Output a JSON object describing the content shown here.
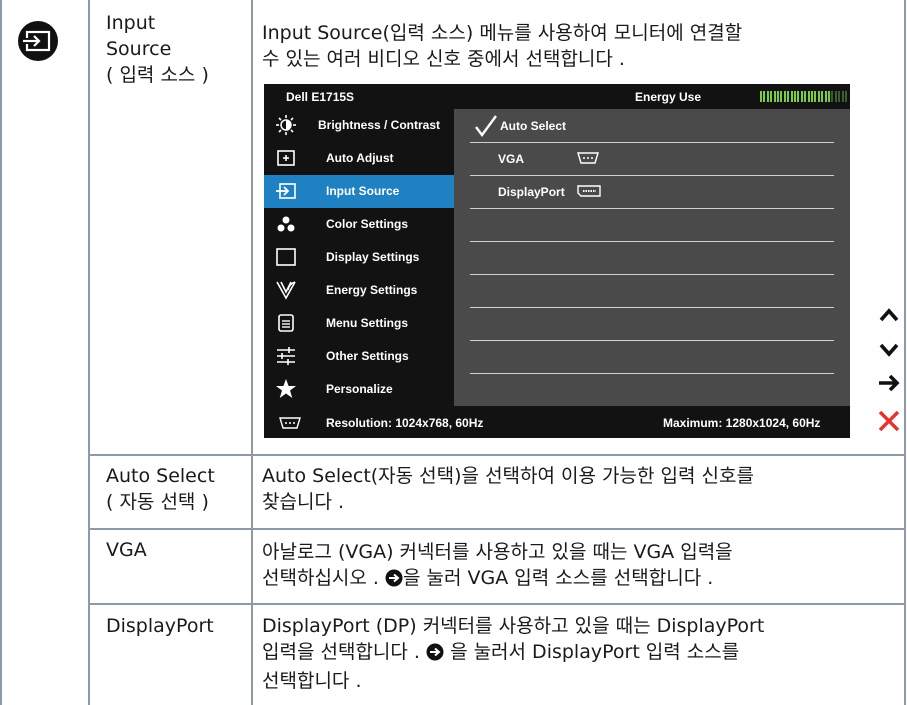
{
  "row1": {
    "name_line1": "Input",
    "name_line2": "Source",
    "name_line3": "( 입력 소스 )",
    "desc_line1": "Input Source(입력 소스) 메뉴를 사용하여 모니터에 연결할",
    "desc_line2": "수 있는 여러 비디오 신호 중에서 선택합니다 ."
  },
  "osd": {
    "model": "Dell E1715S",
    "energy_label": "Energy Use",
    "energy_level": 0.8,
    "menu": [
      {
        "icon": "brightness-icon",
        "label": "Brightness / Contrast"
      },
      {
        "icon": "auto-adjust-icon",
        "label": "Auto Adjust"
      },
      {
        "icon": "input-source-icon",
        "label": "Input Source"
      },
      {
        "icon": "color-settings-icon",
        "label": "Color Settings"
      },
      {
        "icon": "display-settings-icon",
        "label": "Display Settings"
      },
      {
        "icon": "energy-settings-icon",
        "label": "Energy Settings"
      },
      {
        "icon": "menu-settings-icon",
        "label": "Menu Settings"
      },
      {
        "icon": "other-settings-icon",
        "label": "Other Settings"
      },
      {
        "icon": "personalize-icon",
        "label": "Personalize"
      }
    ],
    "selected_menu_index": 2,
    "options": [
      {
        "label": "Auto Select",
        "checked": true,
        "icon": ""
      },
      {
        "label": "VGA",
        "checked": false,
        "icon": "vga-connector-icon"
      },
      {
        "label": "DisplayPort",
        "checked": false,
        "icon": "displayport-connector-icon"
      }
    ],
    "resolution": "Resolution: 1024x768, 60Hz",
    "maximum": "Maximum: 1280x1024, 60Hz"
  },
  "side_buttons": [
    "up-arrow-icon",
    "down-arrow-icon",
    "right-arrow-icon",
    "close-icon"
  ],
  "colors": {
    "selected": "#1f80c2",
    "energy": "#7ccf3a",
    "close": "#e8312b"
  },
  "row2": {
    "name_line1": "Auto Select",
    "name_line2": "( 자동 선택 )",
    "desc_line1": "Auto Select(자동 선택)을 선택하여 이용 가능한 입력 신호를",
    "desc_line2": "찾습니다 ."
  },
  "row3": {
    "name": "VGA",
    "desc_line1": "아날로그 (VGA) 커넥터를 사용하고 있을 때는 VGA 입력을",
    "desc_line2_a": "선택하십시오 .",
    "desc_line2_b": "을 눌러 VGA 입력 소스를 선택합니다 ."
  },
  "row4": {
    "name": "DisplayPort",
    "desc_line1": "DisplayPort (DP) 커넥터를 사용하고 있을 때는 DisplayPort",
    "desc_line2_a": "입력을 선택합니다 .",
    "desc_line2_b": "을 눌러서 DisplayPort 입력 소스를",
    "desc_line3": "선택합니다 ."
  }
}
